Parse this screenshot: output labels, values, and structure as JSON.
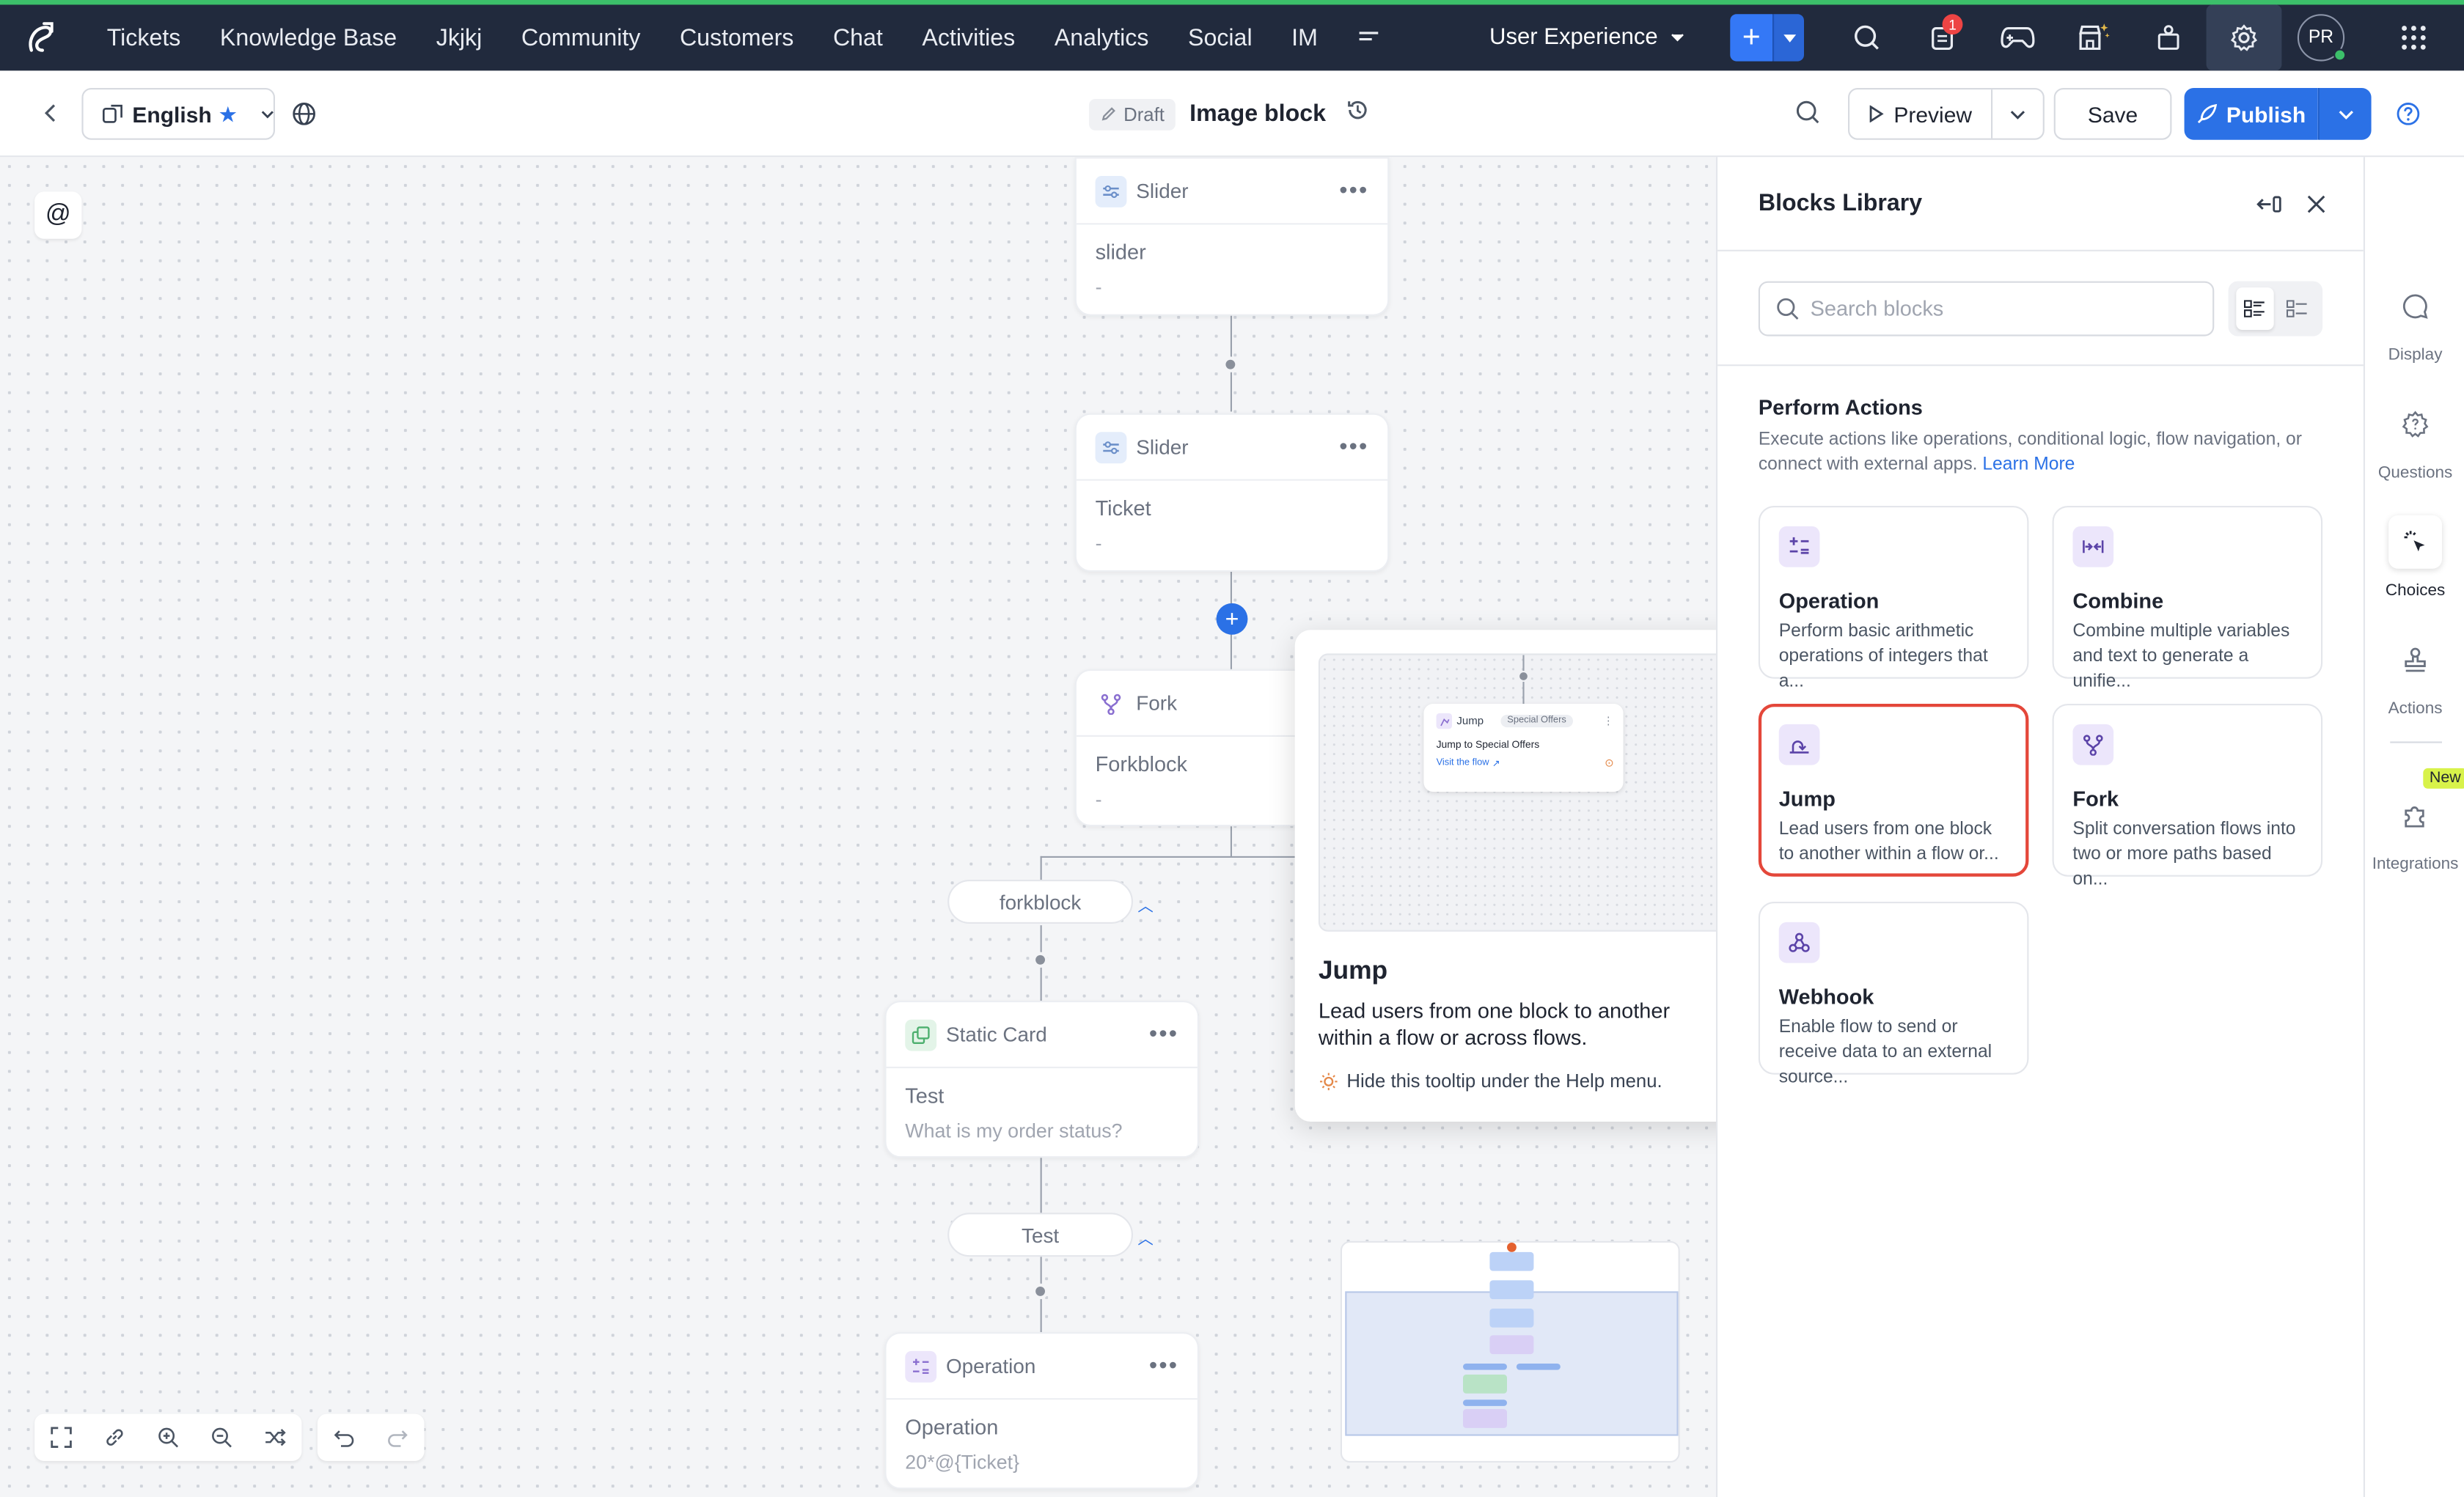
{
  "topnav": {
    "items": [
      "Tickets",
      "Knowledge Base",
      "Jkjkj",
      "Community",
      "Customers",
      "Chat",
      "Activities",
      "Analytics",
      "Social",
      "IM"
    ],
    "department": "User Experience",
    "notification_count": "1",
    "avatar_initials": "PR"
  },
  "subbar": {
    "language": "English",
    "status": "Draft",
    "title": "Image block",
    "preview_label": "Preview",
    "save_label": "Save",
    "publish_label": "Publish"
  },
  "canvas": {
    "at_label": "@",
    "nodes": {
      "slider1": {
        "type": "Slider",
        "title": "slider",
        "sub": "-"
      },
      "slider2": {
        "type": "Slider",
        "title": "Ticket",
        "sub": "-"
      },
      "fork": {
        "type": "Fork",
        "title": "Forkblock",
        "sub": "-"
      },
      "static": {
        "type": "Static Card",
        "title": "Test",
        "sub": "What is my order status?"
      },
      "operation": {
        "type": "Operation",
        "title": "Operation",
        "sub": "20*@{Ticket}"
      }
    },
    "branches": {
      "forkblock": "forkblock",
      "test": "Test"
    }
  },
  "tooltip": {
    "preview": {
      "block": "Jump",
      "tag": "Special Offers",
      "text": "Jump to Special Offers",
      "link": "Visit the flow"
    },
    "title": "Jump",
    "description": "Lead users from one block to another within a flow or across flows.",
    "hint": "Hide this tooltip under the Help menu."
  },
  "panel": {
    "title": "Blocks Library",
    "search_placeholder": "Search blocks",
    "section_title": "Perform Actions",
    "section_desc": "Execute actions like operations, conditional logic, flow navigation, or connect with external apps.",
    "learn_more": "Learn More",
    "cards": [
      {
        "title": "Operation",
        "desc": "Perform basic arithmetic operations of integers that a...",
        "icon": "operation-icon"
      },
      {
        "title": "Combine",
        "desc": "Combine multiple variables and text to generate a unifie...",
        "icon": "combine-icon"
      },
      {
        "title": "Jump",
        "desc": "Lead users from one block to another within a flow or...",
        "icon": "jump-icon"
      },
      {
        "title": "Fork",
        "desc": "Split conversation flows into two or more paths based on...",
        "icon": "fork-icon"
      },
      {
        "title": "Webhook",
        "desc": "Enable flow to send or receive data to an external source...",
        "icon": "webhook-icon"
      }
    ]
  },
  "rail": {
    "items": [
      "Display",
      "Questions",
      "Choices",
      "Actions",
      "Integrations"
    ],
    "active": "Choices",
    "new_badge": "New"
  },
  "colors": {
    "accent": "#2b71e6",
    "nav_bg": "#212a3d",
    "selected_border": "#e4473a",
    "new_badge": "#d8f24a"
  }
}
